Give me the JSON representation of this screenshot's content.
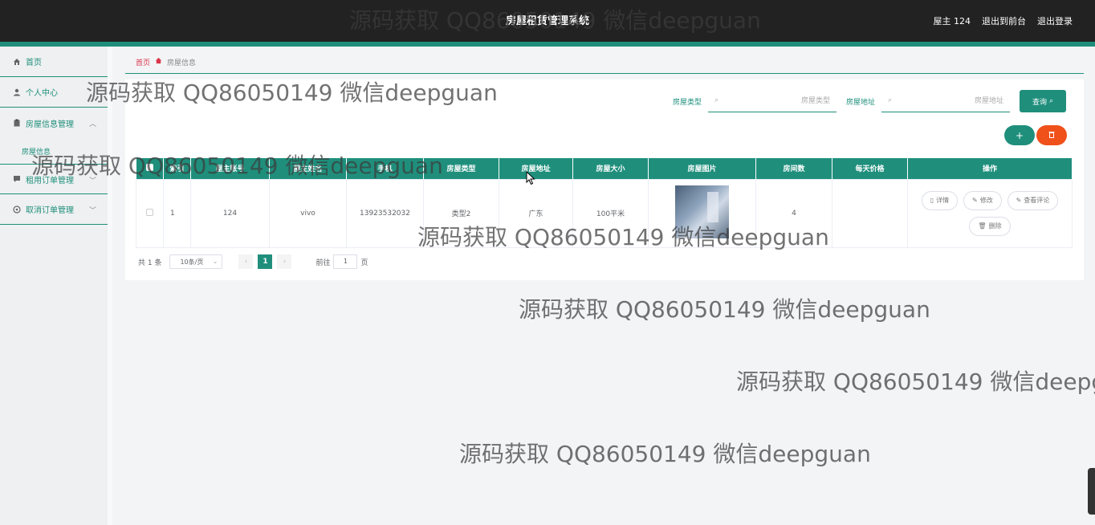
{
  "header": {
    "title": "房屋租赁管理系统",
    "user": "屋主 124",
    "back_to_front": "退出到前台",
    "logout": "退出登录"
  },
  "sidebar": {
    "items": [
      {
        "label": "首页",
        "icon": "home-icon"
      },
      {
        "label": "个人中心",
        "icon": "user-icon"
      },
      {
        "label": "房屋信息管理",
        "icon": "clipboard-icon",
        "expanded": true,
        "children": [
          {
            "label": "房屋信息"
          }
        ]
      },
      {
        "label": "租用订单管理",
        "icon": "chat-icon"
      },
      {
        "label": "取消订单管理",
        "icon": "info-circle-icon"
      }
    ]
  },
  "breadcrumb": {
    "home": "首页",
    "current": "房屋信息"
  },
  "search": {
    "type_label": "房屋类型",
    "type_placeholder": "房屋类型",
    "address_label": "房屋地址",
    "address_placeholder": "房屋地址",
    "button": "查询"
  },
  "table": {
    "columns": [
      "索引",
      "屋主账号",
      "屋主姓名",
      "手机",
      "房屋类型",
      "房屋地址",
      "房屋大小",
      "房屋图片",
      "房间数",
      "每天价格",
      "操作"
    ],
    "rows": [
      {
        "index": "1",
        "owner_account": "124",
        "owner_name": "vivo",
        "phone": "13923532032",
        "house_type": "类型2",
        "address": "广东",
        "size": "100平米",
        "rooms": "4",
        "price": ""
      }
    ],
    "actions": {
      "detail": "详情",
      "edit": "修改",
      "reviews": "查看评论",
      "delete": "删除"
    }
  },
  "pagination": {
    "total": "共 1 条",
    "page_size": "10条/页",
    "current_page": "1",
    "goto_label": "前往",
    "goto_value": "1",
    "page_unit": "页"
  },
  "watermark": {
    "text": "源码获取 QQ86050149 微信deepguan"
  },
  "colors": {
    "accent": "#1f8f7c",
    "danger": "#f0501a",
    "header": "#222222"
  }
}
